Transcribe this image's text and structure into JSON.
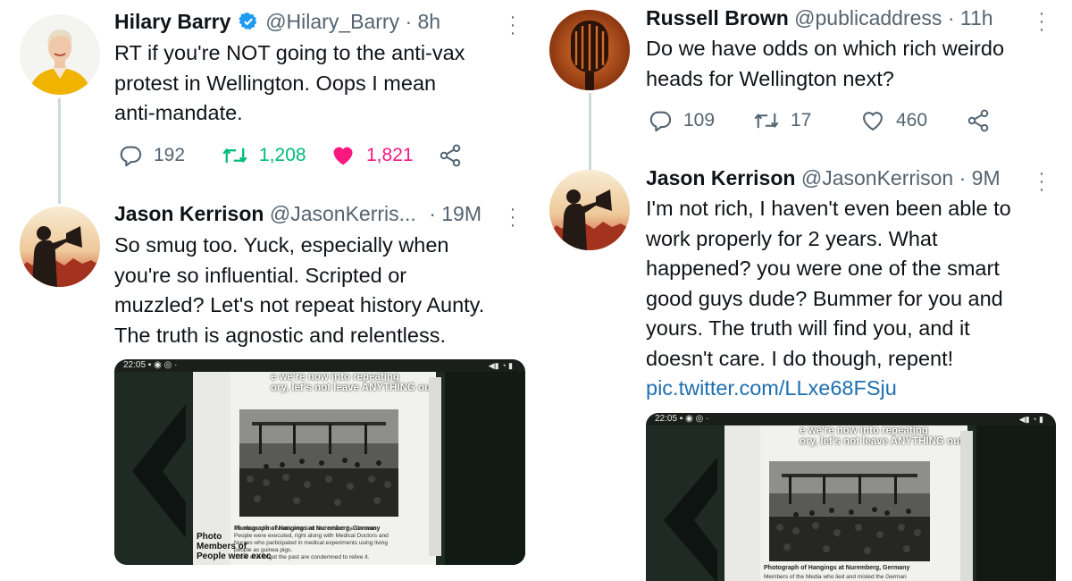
{
  "left": {
    "tweet1": {
      "name": "Hilary Barry",
      "handle": "@Hilary_Barry",
      "time": "· 8h",
      "text_lines": [
        "RT if you're NOT going to the anti-vax",
        "protest in Wellington. Oops I mean",
        "anti-mandate."
      ],
      "replies": "192",
      "retweets": "1,208",
      "likes": "1,821",
      "retweet_color": "#00ba7c",
      "like_color": "#f91880"
    },
    "tweet2": {
      "name": "Jason Kerrison",
      "handle": "@JasonKerris...",
      "time": "· 19M",
      "text_lines": [
        "So smug too. Yuck, especially when",
        "you're so influential. Scripted or",
        "muzzled? Let's not repeat history Aunty.",
        "The truth is agnostic and relentless."
      ],
      "media": {
        "status_time": "22:05",
        "overlay_line1": "e we're now into repeating",
        "overlay_line2": "ory, let's not leave ANYTHING out",
        "caption_title": "Photograph of Hangings at Nuremberg, Germany",
        "caption_body": [
          "Members of the Media who lied and misled the German",
          "People were executed, right along with Medical Doctors and",
          "Nurses who participated in medical experiments using living",
          "people as guinea pigs.",
          "...ose who forgot the past are condemned to relive it."
        ],
        "bottom_line1": "Photo",
        "bottom_line2": "Members of",
        "bottom_line3": "People were exec"
      }
    }
  },
  "right": {
    "tweet1": {
      "name": "Russell Brown",
      "handle": "@publicaddress",
      "time": "· 11h",
      "text_lines": [
        "Do we have odds on which rich weirdo",
        "heads for Wellington next?"
      ],
      "replies": "109",
      "retweets": "17",
      "likes": "460"
    },
    "tweet2": {
      "name": "Jason Kerrison",
      "handle": "@JasonKerrison",
      "time": "· 9M",
      "text_lines": [
        "I'm not rich, I haven't even been able to",
        "work properly for 2 years. What",
        "happened? you were one of the smart",
        "good guys dude? Bummer for you and",
        "yours. The truth will find you, and it",
        "doesn't care. I do though, repent!"
      ],
      "link": "pic.twitter.com/LLxe68FSju",
      "media": {
        "status_time": "22:05",
        "overlay_line1": "e we're now into repeating",
        "overlay_line2": "ory, let's not leave ANYTHING out",
        "caption_title": "Photograph of Hangings at Nuremberg, Germany",
        "caption_body": [
          "Members of the Media who lied and misled the German"
        ]
      }
    }
  },
  "icons": [
    "verified-badge-icon",
    "reply-icon",
    "retweet-icon",
    "like-icon",
    "share-icon",
    "more-icon"
  ]
}
